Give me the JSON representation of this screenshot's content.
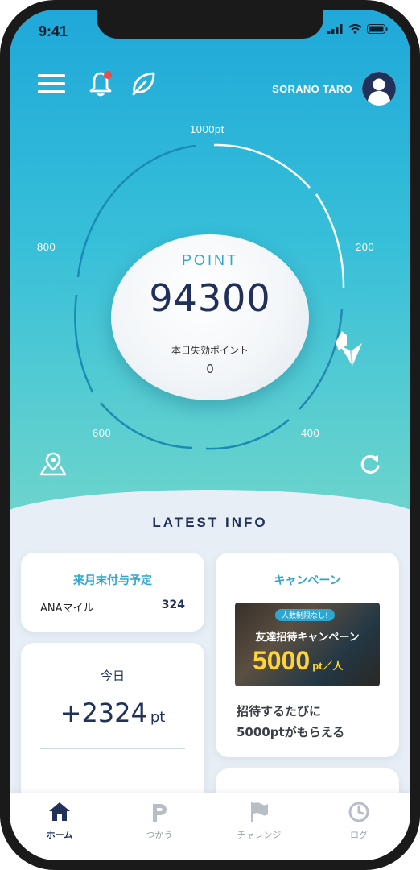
{
  "status_bar": {
    "time": "9:41"
  },
  "header": {
    "username": "SORANO TARO",
    "colors": {
      "accent": "#2ea6cf",
      "navy": "#22315a",
      "notification_dot": "#f04a4a"
    }
  },
  "gauge": {
    "ticks": {
      "top": "1000pt",
      "right": "200",
      "bottom_right": "400",
      "bottom_left": "600",
      "left": "800"
    },
    "point_label": "POINT",
    "point_value": "94300",
    "expiring_label": "本日失効ポイント",
    "expiring_value": "0"
  },
  "latest_info": {
    "title": "LATEST INFO",
    "next_month_card": {
      "title": "来月末付与予定",
      "item_label": "ANAマイル",
      "item_value": "324"
    },
    "today_card": {
      "title": "今日",
      "value": "+2324",
      "unit": "pt"
    },
    "campaign_card": {
      "title": "キャンペーン",
      "banner_badge": "人数制限なし!",
      "banner_heading": "友達招待キャンペーン",
      "banner_amount": "5000",
      "banner_unit": "pt／人",
      "description_line1": "招待するたびに",
      "description_line2": "5000ptがもらえる"
    }
  },
  "tab_bar": {
    "tabs": [
      {
        "label": "ホーム",
        "icon": "home-icon",
        "active": true
      },
      {
        "label": "つかう",
        "icon": "p-icon",
        "active": false
      },
      {
        "label": "チャレンジ",
        "icon": "flag-icon",
        "active": false
      },
      {
        "label": "ログ",
        "icon": "clock-icon",
        "active": false
      }
    ]
  }
}
